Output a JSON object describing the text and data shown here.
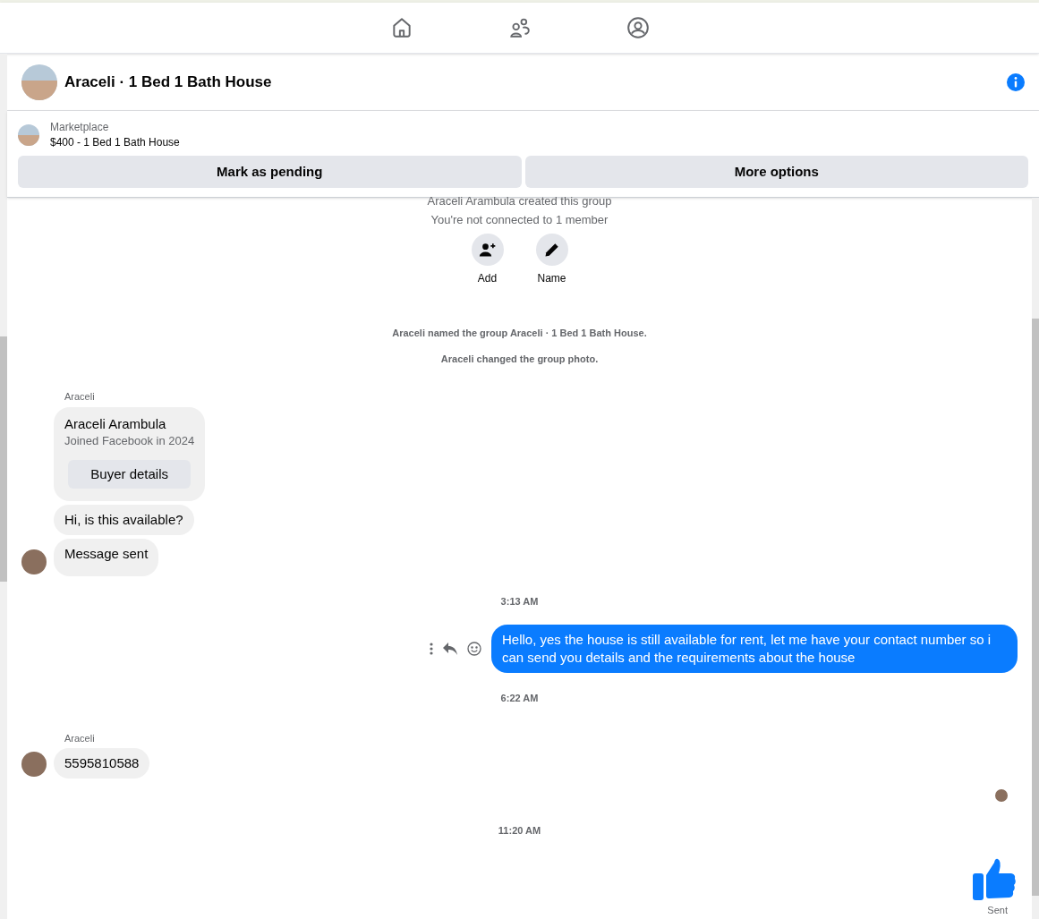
{
  "chat_header": {
    "title": "Araceli · 1 Bed 1 Bath House"
  },
  "listing": {
    "source": "Marketplace",
    "title": "$400 - 1 Bed 1 Bath House",
    "buttons": [
      "Mark as pending",
      "More options"
    ]
  },
  "messages": [
    {
      "kind": "system",
      "text": "Araceli Arambula created this group"
    },
    {
      "kind": "system",
      "text": "You're not connected to 1 member"
    },
    {
      "kind": "actions",
      "items": [
        {
          "label": "Add"
        },
        {
          "label": "Name"
        }
      ]
    },
    {
      "kind": "notice",
      "text": "Araceli named the group Araceli · 1 Bed 1 Bath House."
    },
    {
      "kind": "notice",
      "text": "Araceli changed the group photo."
    },
    {
      "kind": "sender",
      "text": "Araceli"
    },
    {
      "kind": "card",
      "name": "Araceli Arambula",
      "subtitle": "Joined Facebook in 2024",
      "button": "Buyer details",
      "avatar": false
    },
    {
      "kind": "incoming",
      "text": "Hi, is this available?",
      "avatar": false
    },
    {
      "kind": "incoming",
      "text": "Message sent",
      "avatar": true
    },
    {
      "kind": "time",
      "text": "3:13 AM"
    },
    {
      "kind": "outgoing",
      "text": "Hello, yes the house is still available for rent, let me have your contact number so i can send you details and the requirements about the house",
      "hover_actions": true
    },
    {
      "kind": "time",
      "text": "6:22 AM"
    },
    {
      "kind": "sender",
      "text": "Araceli"
    },
    {
      "kind": "incoming",
      "text": "5595810588",
      "avatar": true
    },
    {
      "kind": "seen"
    },
    {
      "kind": "time",
      "text": "11:20 AM"
    },
    {
      "kind": "like",
      "status": "Sent"
    }
  ]
}
